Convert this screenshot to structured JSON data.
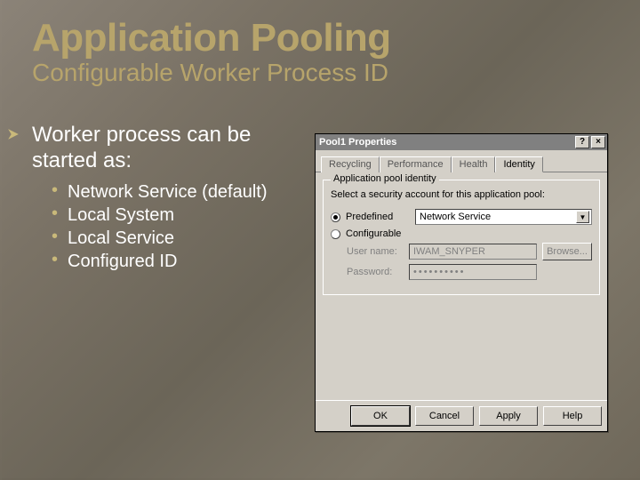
{
  "slide": {
    "title": "Application Pooling",
    "subtitle": "Configurable Worker Process ID",
    "lead": "Worker process can be started as:",
    "bullets": [
      "Network Service (default)",
      "Local System",
      "Local Service",
      "Configured ID"
    ]
  },
  "dialog": {
    "title": "Pool1 Properties",
    "titlebar_buttons": {
      "help": "?",
      "close": "×"
    },
    "tabs": [
      "Recycling",
      "Performance",
      "Health",
      "Identity"
    ],
    "active_tab": "Identity",
    "group_legend": "Application pool identity",
    "hint": "Select a security account for this application pool:",
    "radios": {
      "predefined_label": "Predefined",
      "configurable_label": "Configurable"
    },
    "predefined_value": "Network Service",
    "fields": {
      "username_label": "User name:",
      "username_value": "IWAM_SNYPER",
      "password_label": "Password:",
      "password_value": "••••••••••",
      "browse_label": "Browse..."
    },
    "buttons": {
      "ok": "OK",
      "cancel": "Cancel",
      "apply": "Apply",
      "help": "Help"
    }
  }
}
